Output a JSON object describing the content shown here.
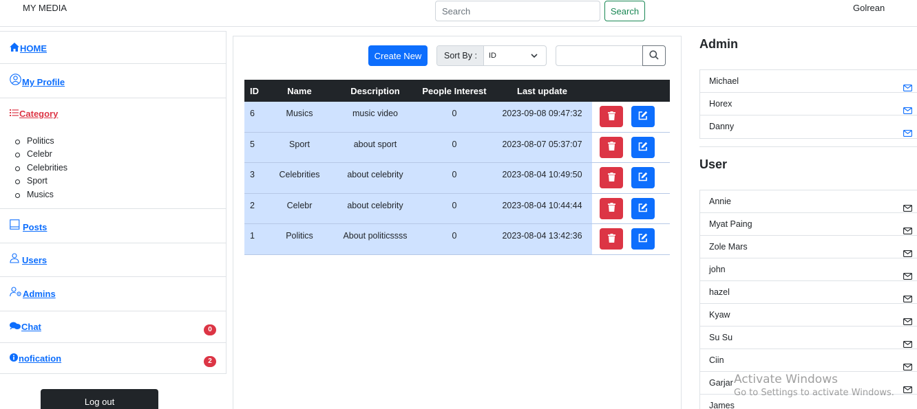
{
  "topbar": {
    "brand": "MY MEDIA",
    "search_placeholder": "Search",
    "search_button": "Search",
    "username": "Golrean"
  },
  "sidebar": {
    "home": "HOME",
    "profile": "My Profile",
    "category": "Category",
    "categories": [
      "Politics",
      "Celebr",
      "Celebrities",
      "Sport",
      "Musics"
    ],
    "posts": "Posts",
    "users": "Users",
    "admins": "Admins",
    "chat": "Chat",
    "chat_count": "0",
    "notification": "nofication",
    "notification_count": "2",
    "logout": "Log out"
  },
  "toolbar": {
    "create_new": "Create New",
    "sort_label": "Sort By :",
    "sort_value": "ID",
    "search_value": ""
  },
  "table": {
    "headers": [
      "ID",
      "Name",
      "Description",
      "People Interest",
      "Last update"
    ],
    "rows": [
      {
        "id": "6",
        "name": "Musics",
        "description": "music video",
        "interest": "0",
        "updated": "2023-09-08 09:47:32"
      },
      {
        "id": "5",
        "name": "Sport",
        "description": "about sport",
        "interest": "0",
        "updated": "2023-08-07 05:37:07"
      },
      {
        "id": "3",
        "name": "Celebrities",
        "description": "about celebrity",
        "interest": "0",
        "updated": "2023-08-04 10:49:50"
      },
      {
        "id": "2",
        "name": "Celebr",
        "description": "about celebrity",
        "interest": "0",
        "updated": "2023-08-04 10:44:44"
      },
      {
        "id": "1",
        "name": "Politics",
        "description": "About politicssss",
        "interest": "0",
        "updated": "2023-08-04 13:42:36"
      }
    ]
  },
  "admins": {
    "title": "Admin",
    "names": [
      "Michael",
      "Horex",
      "Danny"
    ],
    "icon_color": "#0d6efd"
  },
  "users": {
    "title": "User",
    "names": [
      "Annie",
      "Myat Paing",
      "Zole Mars",
      "john",
      "hazel",
      "Kyaw",
      "Su Su",
      "Ciin",
      "Garjar",
      "James"
    ],
    "icon_color": "#212529"
  },
  "watermark": {
    "line1": "Activate Windows",
    "line2": "Go to Settings to activate Windows."
  },
  "colors": {
    "primary": "#0d6efd",
    "danger": "#dc3545",
    "success": "#198754",
    "dark": "#212529",
    "row_bg": "#cfe2ff"
  }
}
